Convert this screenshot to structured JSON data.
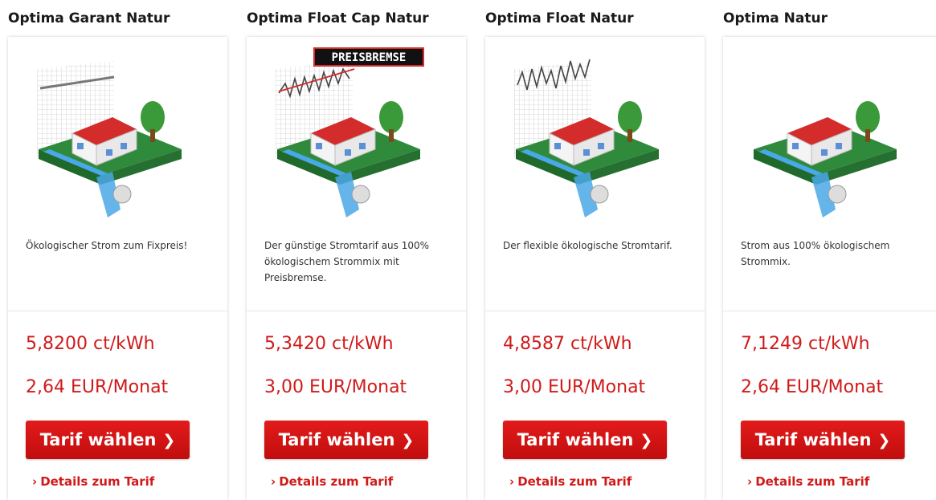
{
  "colors": {
    "accent_red": "#d01a1a",
    "button_red": "#e31b1b",
    "house_roof": "#d42b2b",
    "grass": "#2f8a3b",
    "water": "#4aa8e8"
  },
  "tariffs": [
    {
      "title": "Optima Garant Natur",
      "description": "Ökologischer Strom zum Fixpreis!",
      "price": "5,8200 ct/kWh",
      "monthly": "2,64 EUR/Monat",
      "button_label": "Tarif wählen",
      "details_label": "Details zum Tarif",
      "illustration": "house-with-flat-line-chart"
    },
    {
      "title": "Optima Float Cap Natur",
      "description": "Der günstige Stromtarif aus 100% ökologischem Strommix mit Preisbremse.",
      "price": "5,3420 ct/kWh",
      "monthly": "3,00 EUR/Monat",
      "button_label": "Tarif wählen",
      "details_label": "Details zum Tarif",
      "badge": "PREISBREMSE",
      "illustration": "house-with-capped-fluctuating-chart"
    },
    {
      "title": "Optima Float Natur",
      "description": "Der flexible ökologische Stromtarif.",
      "price": "4,8587 ct/kWh",
      "monthly": "3,00 EUR/Monat",
      "button_label": "Tarif wählen",
      "details_label": "Details zum Tarif",
      "illustration": "house-with-fluctuating-chart"
    },
    {
      "title": "Optima Natur",
      "description": "Strom aus 100% ökologischem Strommix.",
      "price": "7,1249 ct/kWh",
      "monthly": "2,64 EUR/Monat",
      "button_label": "Tarif wählen",
      "details_label": "Details zum Tarif",
      "illustration": "house-only"
    }
  ]
}
